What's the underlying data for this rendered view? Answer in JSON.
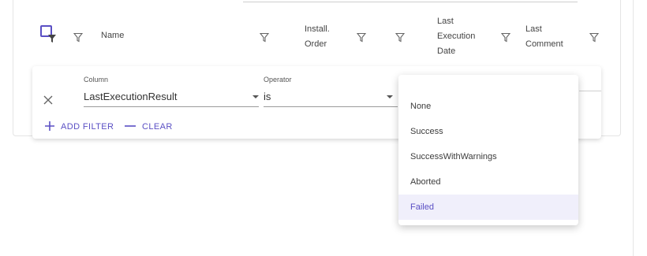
{
  "grid": {
    "columns": [
      {
        "label": "Name"
      },
      {
        "label": "Install. Order"
      },
      {
        "label": "Last Execution Date"
      },
      {
        "label": "Last Comment"
      }
    ]
  },
  "filter": {
    "column_label": "Column",
    "column_value": "LastExecutionResult",
    "operator_label": "Operator",
    "operator_value": "is",
    "add_filter_label": "ADD FILTER",
    "clear_label": "CLEAR"
  },
  "dropdown": {
    "options": [
      "None",
      "Success",
      "SuccessWithWarnings",
      "Aborted",
      "Failed"
    ],
    "selected": "Failed"
  },
  "colors": {
    "accent": "#5a4fc4",
    "selected_bg": "#f0effb"
  },
  "icons": {
    "close": "close-icon",
    "add": "plus-icon",
    "clear": "minus-icon",
    "filter": "funnel-icon"
  }
}
